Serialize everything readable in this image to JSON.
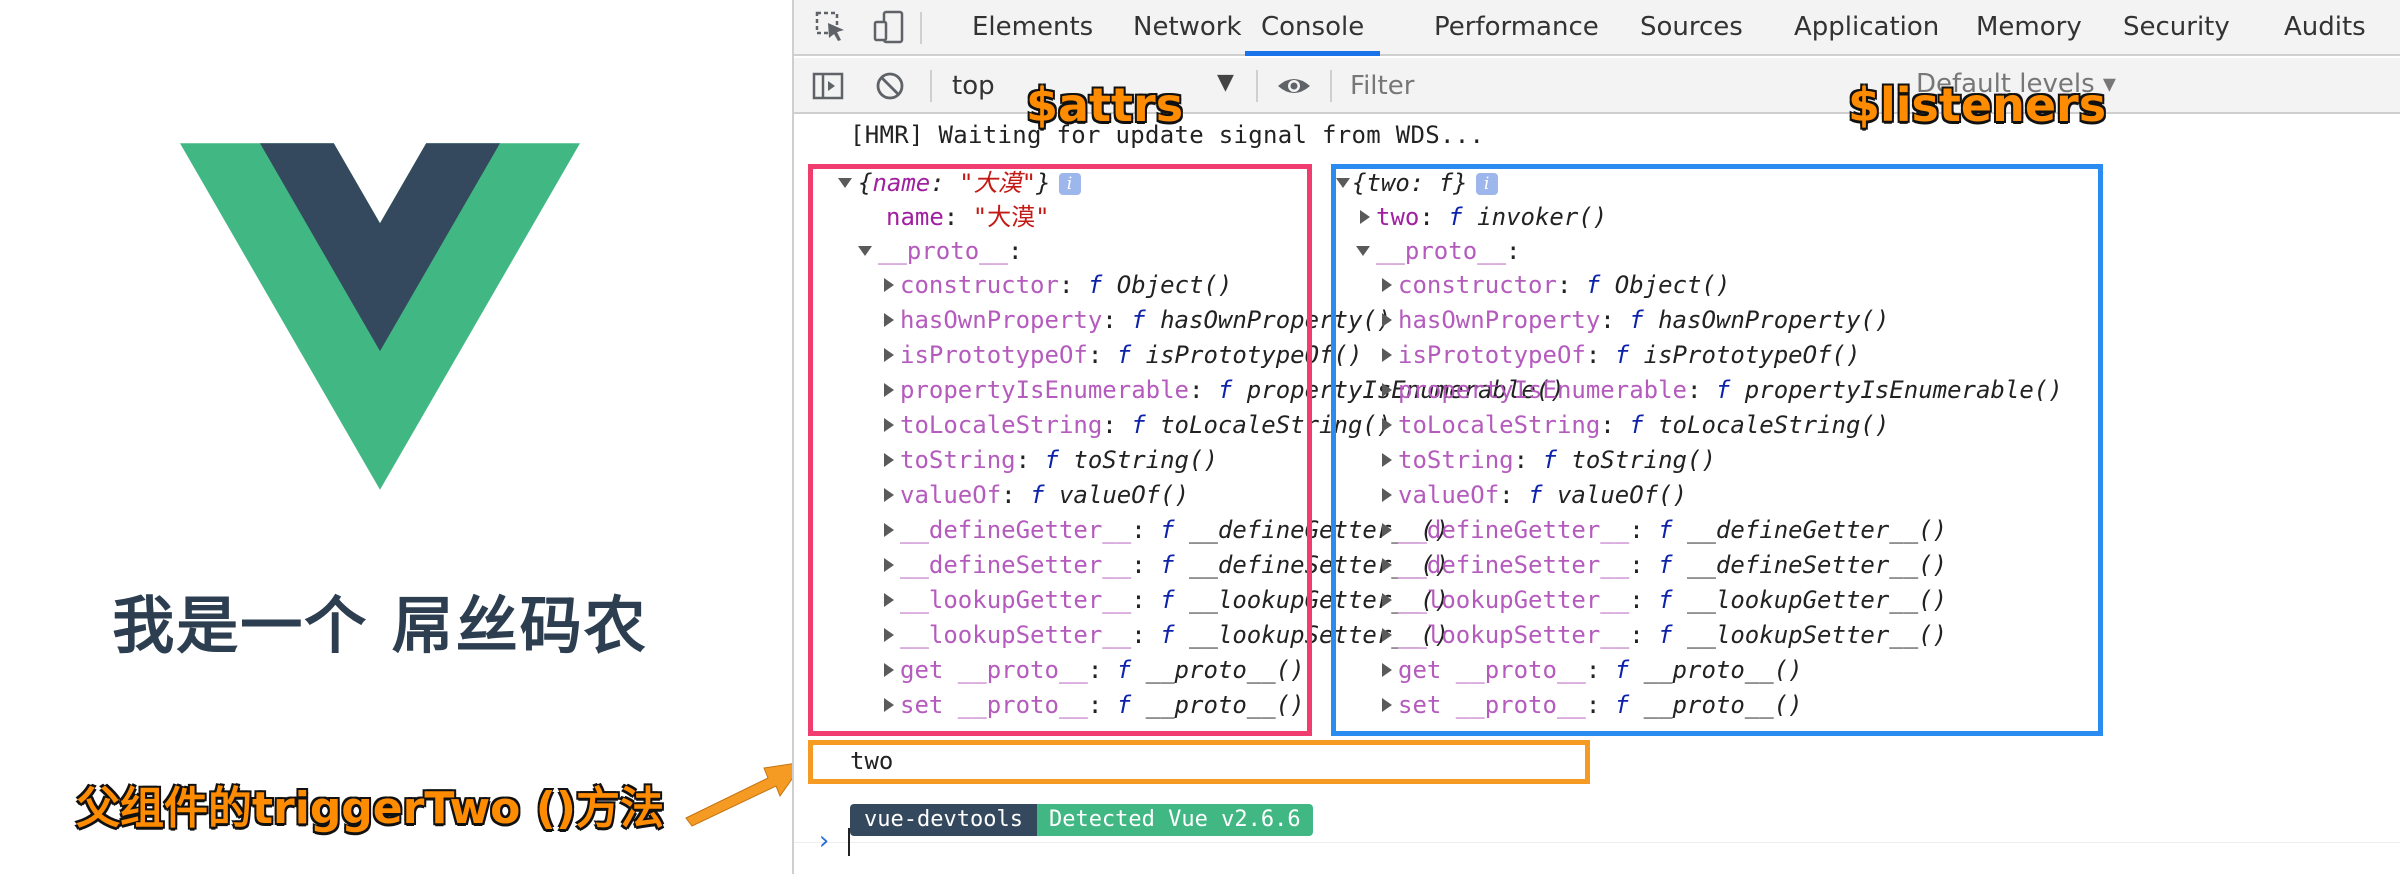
{
  "app": {
    "title_text": "我是一个 屌丝码农",
    "caption_method": "父组件的triggerTwo ()方法",
    "logo_colors": {
      "outer": "#41b883",
      "inner": "#35495e"
    }
  },
  "devtools": {
    "tabs": [
      "Elements",
      "Network",
      "Console",
      "Performance",
      "Sources",
      "Application",
      "Memory",
      "Security",
      "Audits"
    ],
    "active_tab": "Console",
    "toolbar": {
      "context": "top",
      "filter_placeholder": "Filter",
      "levels": "Default levels ▾"
    },
    "hmr_message": "[HMR] Waiting for update signal from WDS...",
    "attrs_label": "$attrs",
    "listeners_label": "$listeners",
    "attrs": {
      "summary_key": "name",
      "summary_value": "\"大漠\"",
      "name_key": "name",
      "name_value": "\"大漠\"",
      "proto_label": "__proto__",
      "proto_items": [
        {
          "key": "constructor",
          "fn": "Object()"
        },
        {
          "key": "hasOwnProperty",
          "fn": "hasOwnProperty()"
        },
        {
          "key": "isPrototypeOf",
          "fn": "isPrototypeOf()"
        },
        {
          "key": "propertyIsEnumerable",
          "fn": "propertyIsEnumerable()"
        },
        {
          "key": "toLocaleString",
          "fn": "toLocaleString()"
        },
        {
          "key": "toString",
          "fn": "toString()"
        },
        {
          "key": "valueOf",
          "fn": "valueOf()"
        },
        {
          "key": "__defineGetter__",
          "fn": "__defineGetter__()"
        },
        {
          "key": "__defineSetter__",
          "fn": "__defineSetter__()"
        },
        {
          "key": "__lookupGetter__",
          "fn": "__lookupGetter__()"
        },
        {
          "key": "__lookupSetter__",
          "fn": "__lookupSetter__()"
        },
        {
          "key": "get __proto__",
          "fn": "__proto__()"
        },
        {
          "key": "set __proto__",
          "fn": "__proto__()"
        }
      ]
    },
    "listeners": {
      "summary_key": "two",
      "summary_value": "f",
      "two_key": "two",
      "two_fn": "invoker()",
      "proto_label": "__proto__",
      "proto_items": [
        {
          "key": "constructor",
          "fn": "Object()"
        },
        {
          "key": "hasOwnProperty",
          "fn": "hasOwnProperty()"
        },
        {
          "key": "isPrototypeOf",
          "fn": "isPrototypeOf()"
        },
        {
          "key": "propertyIsEnumerable",
          "fn": "propertyIsEnumerable()"
        },
        {
          "key": "toLocaleString",
          "fn": "toLocaleString()"
        },
        {
          "key": "toString",
          "fn": "toString()"
        },
        {
          "key": "valueOf",
          "fn": "valueOf()"
        },
        {
          "key": "__defineGetter__",
          "fn": "__defineGetter__()"
        },
        {
          "key": "__defineSetter__",
          "fn": "__defineSetter__()"
        },
        {
          "key": "__lookupGetter__",
          "fn": "__lookupGetter__()"
        },
        {
          "key": "__lookupSetter__",
          "fn": "__lookupSetter__()"
        },
        {
          "key": "get __proto__",
          "fn": "__proto__()"
        },
        {
          "key": "set __proto__",
          "fn": "__proto__()"
        }
      ]
    },
    "two_output": "two",
    "badge_devtools": "vue-devtools",
    "badge_detected": "Detected Vue v2.6.6",
    "prompt_symbol": "›",
    "colors": {
      "attrs_box": "#f03c6e",
      "listeners_box": "#2a8cf0",
      "output_box": "#f59a23",
      "active_tab": "#1a73e8"
    }
  }
}
